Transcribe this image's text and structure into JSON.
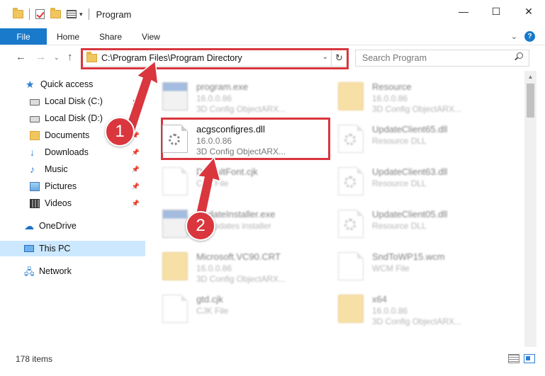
{
  "window": {
    "title": "Program",
    "controls": {
      "minimize": "—",
      "maximize": "☐",
      "close": "✕"
    }
  },
  "ribbon": {
    "tabs": [
      "File",
      "Home",
      "Share",
      "View"
    ],
    "help": "?"
  },
  "address_bar": {
    "path": "C:\\Program Files\\Program Directory",
    "refresh_glyph": "↻"
  },
  "search": {
    "placeholder": "Search Program"
  },
  "sidebar": {
    "items": [
      {
        "label": "Quick access",
        "icon": "star-icon",
        "pinned": false
      },
      {
        "label": "Local Disk (C:)",
        "icon": "disk-icon",
        "pinned": true
      },
      {
        "label": "Local Disk (D:)",
        "icon": "disk-icon",
        "pinned": true
      },
      {
        "label": "Documents",
        "icon": "documents-icon",
        "pinned": true
      },
      {
        "label": "Downloads",
        "icon": "download-icon",
        "pinned": true
      },
      {
        "label": "Music",
        "icon": "music-icon",
        "pinned": true
      },
      {
        "label": "Pictures",
        "icon": "pictures-icon",
        "pinned": true
      },
      {
        "label": "Videos",
        "icon": "videos-icon",
        "pinned": true
      },
      {
        "label": "OneDrive",
        "icon": "cloud-icon",
        "pinned": false
      },
      {
        "label": "This PC",
        "icon": "computer-icon",
        "pinned": false,
        "selected": true
      },
      {
        "label": "Network",
        "icon": "network-icon",
        "pinned": false
      }
    ]
  },
  "files": {
    "left": [
      {
        "name": "program.exe",
        "line1": "16.0.0.86",
        "line2": "3D Config ObjectARX...",
        "icon": "exe-icon",
        "blurred": true
      },
      {
        "name": "acgsconfigres.dll",
        "line1": "16.0.0.86",
        "line2": "3D Config ObjectARX...",
        "icon": "dll-gear-icon",
        "blurred": false
      },
      {
        "name": "DefaultFont.cjk",
        "line1": "CJK File",
        "line2": "",
        "icon": "document-icon",
        "blurred": true
      },
      {
        "name": "UpdateInstaller.exe",
        "line1": "AY updates installer",
        "line2": "",
        "icon": "exe-icon",
        "blurred": true
      },
      {
        "name": "Microsoft.VC90.CRT",
        "line1": "16.0.0.86",
        "line2": "3D Config ObjectARX...",
        "icon": "folder-icon",
        "blurred": true
      },
      {
        "name": "gtd.cjk",
        "line1": "CJK File",
        "line2": "",
        "icon": "document-icon",
        "blurred": true
      }
    ],
    "right": [
      {
        "name": "Resource",
        "line1": "16.0.0.86",
        "line2": "3D Config ObjectARX...",
        "icon": "folder-icon",
        "blurred": true
      },
      {
        "name": "UpdateClient65.dll",
        "line1": "Resource DLL",
        "line2": "",
        "icon": "dll-gear-icon",
        "blurred": true
      },
      {
        "name": "UpdateClient63.dll",
        "line1": "Resource DLL",
        "line2": "",
        "icon": "dll-gear-icon",
        "blurred": true
      },
      {
        "name": "UpdateClient05.dll",
        "line1": "Resource DLL",
        "line2": "",
        "icon": "dll-gear-icon",
        "blurred": true
      },
      {
        "name": "SndToWP15.wcm",
        "line1": "WCM File",
        "line2": "",
        "icon": "document-icon",
        "blurred": true
      },
      {
        "name": "x64",
        "line1": "16.0.0.86",
        "line2": "3D Config ObjectARX...",
        "icon": "folder-icon",
        "blurred": true
      }
    ]
  },
  "status": {
    "item_count": "178 items"
  },
  "annotations": {
    "badge1": "1",
    "badge2": "2",
    "highlight_color": "#d9363e"
  },
  "colors": {
    "accent": "#1979ca",
    "selected_bg": "#cce8ff"
  }
}
